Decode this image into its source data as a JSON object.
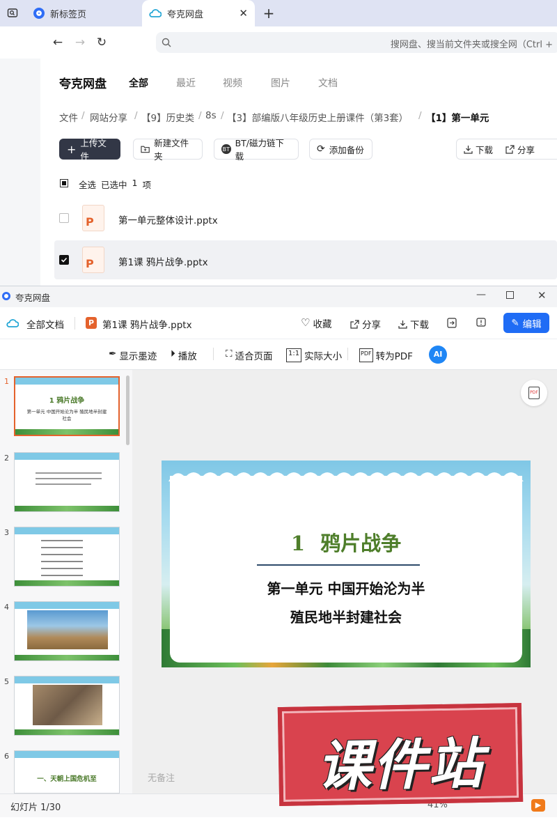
{
  "browser": {
    "tabs": [
      {
        "label": "新标签页"
      },
      {
        "label": "夸克网盘"
      }
    ],
    "search_placeholder": "搜网盘、搜当前文件夹或搜全网（Ctrl +"
  },
  "drive": {
    "logo": "夸克网盘",
    "nav": [
      "全部",
      "最近",
      "视频",
      "图片",
      "文档"
    ],
    "breadcrumb": [
      "文件",
      "网站分享",
      "【9】历史类",
      "8s",
      "【3】部编版八年级历史上册课件（第3套）",
      "【1】第一单元"
    ],
    "actions": {
      "upload": "上传文件",
      "new_folder": "新建文件夹",
      "bt": "BT/磁力链下载",
      "backup": "添加备份",
      "download": "下载",
      "share": "分享"
    },
    "selection": {
      "select_all": "全选",
      "selected_prefix": "已选中",
      "count": "1",
      "suffix": "项"
    },
    "files": [
      {
        "name": "第一单元整体设计.pptx",
        "checked": false
      },
      {
        "name": "第1课 鸦片战争.pptx",
        "checked": true
      }
    ]
  },
  "viewer": {
    "window_title": "夸克网盘",
    "all_docs": "全部文档",
    "file_name": "第1课 鸦片战争.pptx",
    "top_actions": {
      "favorite": "收藏",
      "share": "分享",
      "download": "下载",
      "edit": "编辑"
    },
    "tools": {
      "ink": "显示墨迹",
      "play": "播放",
      "fit": "适合页面",
      "actual": "实际大小",
      "pdf": "转为PDF",
      "ai": "AI"
    },
    "slide": {
      "title": "1 鸦片战争",
      "line1": "第一单元 中国开始沦为半",
      "line2": "殖民地半封建社会"
    },
    "thumbs": [
      {
        "num": "1",
        "title": "1 鸦片战争",
        "sub": "第一单元 中国开始沦为半 殖民地半封建社会"
      },
      {
        "num": "2"
      },
      {
        "num": "3"
      },
      {
        "num": "4"
      },
      {
        "num": "5"
      },
      {
        "num": "6",
        "title": "一、天朝上国危机至"
      }
    ],
    "notes_placeholder": "无备注",
    "status": "幻灯片 1/30",
    "zoom": "41%",
    "watermark": "课件站"
  }
}
